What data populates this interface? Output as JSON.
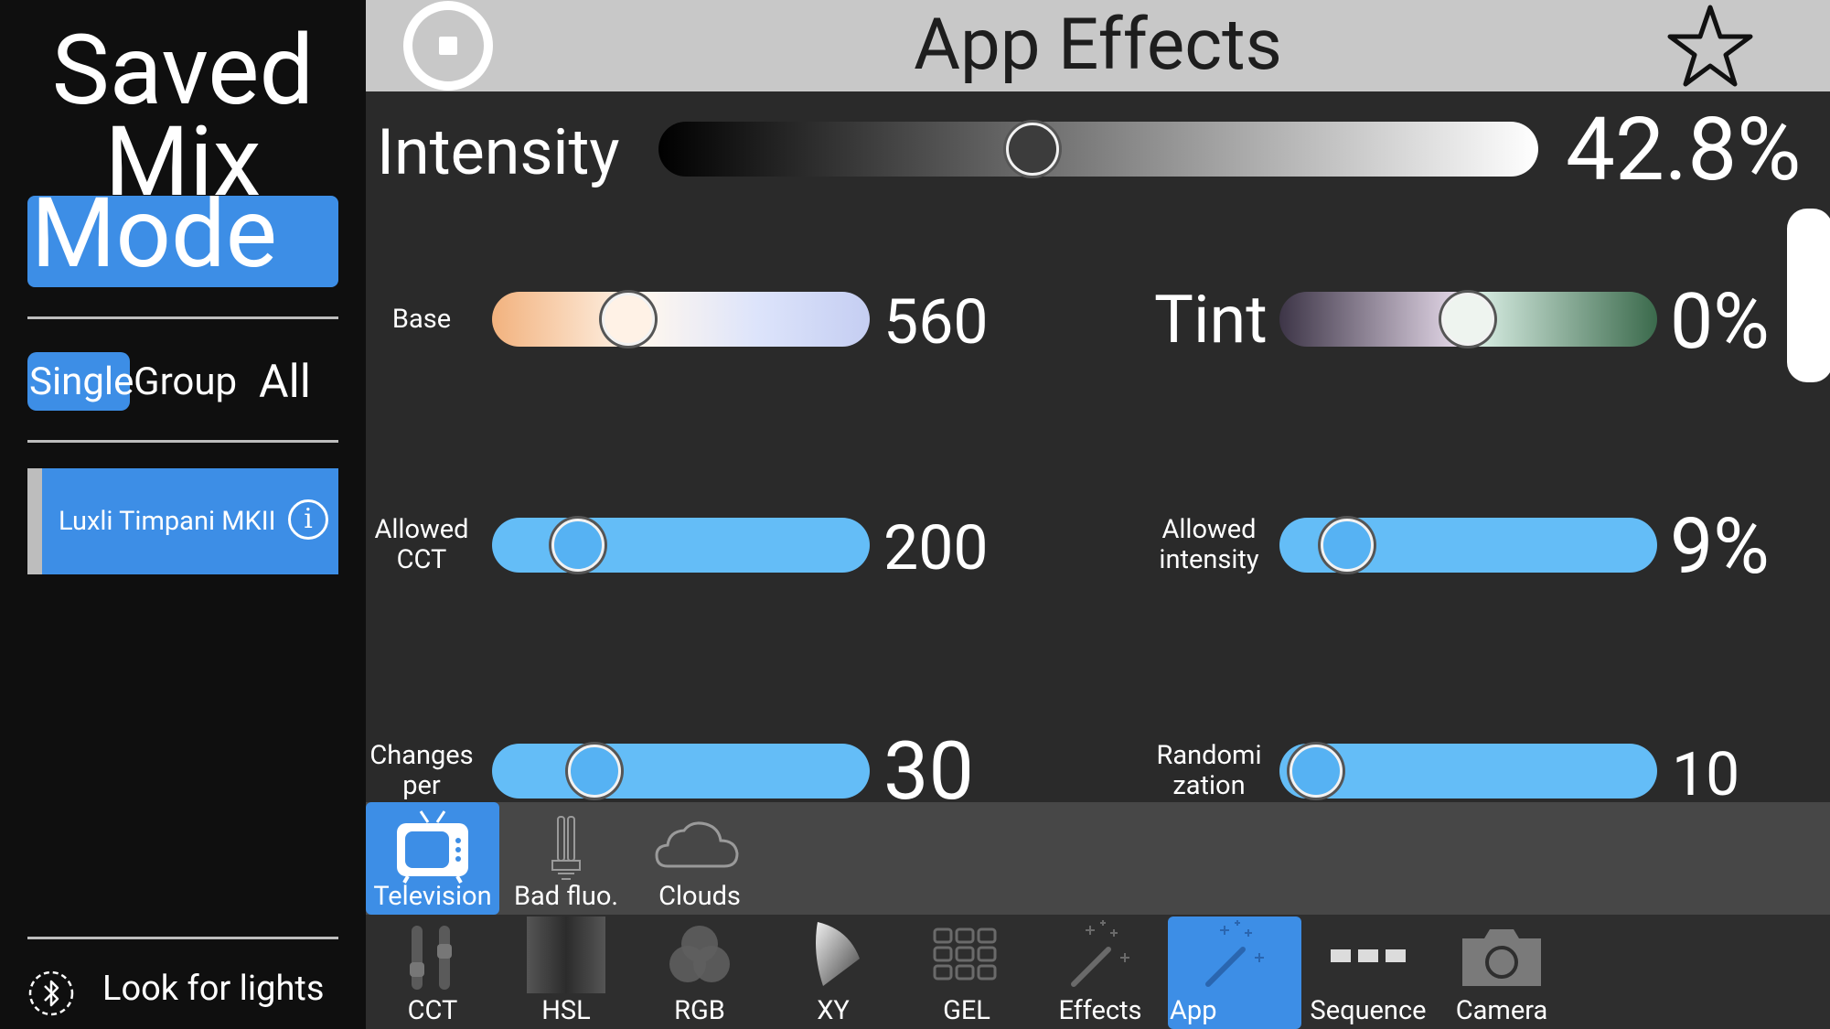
{
  "sidebar": {
    "mode_title": {
      "line1": "Saved",
      "line2": "Mix",
      "line3": "Mode"
    },
    "selection": {
      "single": "Single",
      "group": "Group",
      "all": "All"
    },
    "light_item": {
      "label": "Luxli Timpani MKII",
      "info": "i"
    },
    "look_for_lights": "Look for lights"
  },
  "header": {
    "title": "App Effects",
    "left_icon": "stop-icon",
    "right_icon": "star-icon"
  },
  "intensity": {
    "label": "Intensity",
    "value_text": "42.8%",
    "value": 42.8
  },
  "controls": {
    "base": {
      "label": "Base",
      "value_text": "560",
      "position": 0.37
    },
    "tint": {
      "label": "Tint",
      "value_text": "0%",
      "position": 0.5
    },
    "allowed_cct": {
      "label_line1": "Allowed",
      "label_line2": "CCT",
      "value_text": "200",
      "position": 0.23
    },
    "allowed_intensity": {
      "label_line1": "Allowed",
      "label_line2": "intensity",
      "value_text": "9%",
      "position": 0.19
    },
    "changes_per": {
      "label_line1": "Changes",
      "label_line2": "per",
      "value_text": "30",
      "position": 0.28
    },
    "randomization": {
      "label_line1": "Randomi",
      "label_line2": "zation",
      "value_text": "10",
      "position": 0.1
    }
  },
  "effects": [
    {
      "label": "Television",
      "icon": "television-icon",
      "selected": true
    },
    {
      "label": "Bad fluo.",
      "icon": "fluorescent-tube-icon",
      "selected": false
    },
    {
      "label": "Clouds",
      "icon": "cloud-icon",
      "selected": false
    }
  ],
  "nav": [
    {
      "label": "CCT",
      "icon": "cct-sliders-icon"
    },
    {
      "label": "HSL",
      "icon": "hsl-gradient-icon"
    },
    {
      "label": "RGB",
      "icon": "rgb-circles-icon"
    },
    {
      "label": "XY",
      "icon": "xy-cone-icon"
    },
    {
      "label": "GEL",
      "icon": "gel-grid-icon"
    },
    {
      "label": "Effects",
      "icon": "magic-wand-icon"
    },
    {
      "label": "App",
      "icon": "magic-wand-icon"
    },
    {
      "label": "Sequence",
      "icon": "sequence-icon"
    },
    {
      "label": "Camera",
      "icon": "camera-icon"
    }
  ],
  "colors": {
    "accent": "#3d8ee6",
    "slider_blue": "#64bdf7",
    "sidebar_bg": "#0f0f0f",
    "main_bg": "#2a2a2a",
    "header_bg": "#c8c8c8"
  }
}
